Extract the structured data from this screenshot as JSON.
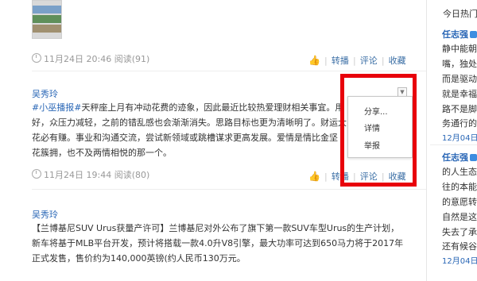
{
  "feed": {
    "post1": {
      "time": "11月24日 20:46",
      "read": "阅读(91)",
      "actions": {
        "forward": "转播",
        "comment": "评论",
        "collect": "收藏"
      }
    },
    "post2": {
      "author": "吴秀玲",
      "tag": "#小巫播报#",
      "text_l1_rest": "天秤座上月有冲动花费的迹象，因此最近比较热爱理财相关事宜。用",
      "text_l2": "好，众压力减轻，之前的错乱感也会渐渐消失。思路目标也更为清晰明了。财运大",
      "text_l3": "花必有赚。事业和沟通交流，尝试新领域或跳槽谋求更高发展。爱情是情比金坚",
      "text_l4": "花簇拥，也不及两情相悦的那一个。",
      "time": "11月24日 19:44",
      "read": "阅读(80)",
      "actions": {
        "forward": "转播",
        "comment": "评论",
        "collect": "收藏"
      }
    },
    "popup": {
      "share": "分享...",
      "detail": "详情",
      "report": "举报"
    },
    "post3": {
      "author": "吴秀玲",
      "text_l1": "【兰博基尼SUV Urus获量产许可】兰博基尼对外公布了旗下第一款SUV车型Urus的生产计划，",
      "text_l2": "新车将基于MLB平台开发，预计将搭载一款4.0升V8引擎，最大功率可达到650马力将于2017年",
      "text_l3": "正式发售，售价约为140,000英镑(约人民币130万元。"
    }
  },
  "sidebar": {
    "title": "今日热门",
    "entry1": {
      "name": "任志强",
      "lines": [
        "静中能朝",
        "嘴，独处",
        "而是驱动",
        "就是幸福",
        "路不是脚",
        "务通行的"
      ],
      "date": "12月04日"
    },
    "entry2": {
      "name": "任志强",
      "lines": [
        "的人生态",
        "往的本能",
        "的意愿转",
        "自然是这",
        "失去了承",
        "还有候谷"
      ],
      "date": "12月04日"
    }
  },
  "colors": {
    "link": "#2a67b6",
    "highlight_box": "#e8000b",
    "meta": "#999999"
  },
  "icons": [
    "clock-icon",
    "thumbs-up-icon",
    "dropdown-caret-icon",
    "verified-icon"
  ]
}
